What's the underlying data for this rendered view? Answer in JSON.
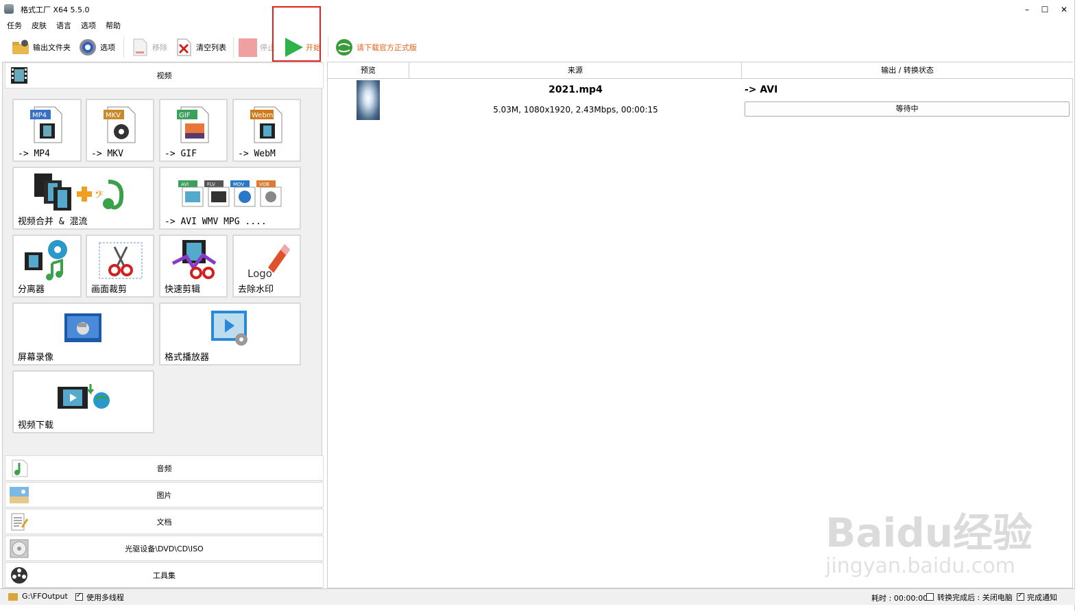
{
  "window": {
    "title": "格式工厂 X64 5.5.0"
  },
  "menu": [
    "任务",
    "皮肤",
    "语言",
    "选项",
    "帮助"
  ],
  "toolbar": {
    "output_folder": "输出文件夹",
    "options": "选项",
    "remove": "移除",
    "clear_list": "清空列表",
    "stop": "停止",
    "start": "开始",
    "download_official": "请下载官方正式版"
  },
  "categories": {
    "video": "视频",
    "audio": "音频",
    "image": "图片",
    "document": "文档",
    "disc": "光驱设备\\DVD\\CD\\ISO",
    "tools": "工具集"
  },
  "tiles": [
    {
      "label": "-> MP4",
      "badge": "MP4"
    },
    {
      "label": "-> MKV",
      "badge": "MKV"
    },
    {
      "label": "-> GIF",
      "badge": "GIF"
    },
    {
      "label": "-> WebM",
      "badge": "Webm"
    },
    {
      "label": "视频合并 & 混流"
    },
    {
      "label": "-> AVI WMV MPG ....",
      "badges": [
        "AVI",
        "FLV",
        "MOV",
        "VOB"
      ]
    },
    {
      "label": "分离器"
    },
    {
      "label": "画面裁剪"
    },
    {
      "label": "快速剪辑"
    },
    {
      "label": "去除水印",
      "logo_text": "Logo"
    },
    {
      "label": "屏幕录像"
    },
    {
      "label": "格式播放器"
    },
    {
      "label": "视频下载"
    }
  ],
  "list": {
    "headers": {
      "preview": "预览",
      "source": "来源",
      "output": "输出 / 转换状态"
    },
    "rows": [
      {
        "filename": "2021.mp4",
        "info": "5.03M, 1080x1920, 2.43Mbps, 00:00:15",
        "target": "-> AVI",
        "status": "等待中"
      }
    ]
  },
  "status": {
    "output_path": "G:\\FFOutput",
    "multithread": "使用多线程",
    "elapsed": "耗时 : 00:00:00",
    "after_done": "转换完成后 : 关闭电脑",
    "notify": "完成通知"
  },
  "watermark": {
    "brand": "Baidu经验",
    "url": "jingyan.baidu.com"
  },
  "colors": {
    "highlight": "#e02020",
    "start_green": "#2db34a",
    "download_orange": "#e8641e"
  }
}
